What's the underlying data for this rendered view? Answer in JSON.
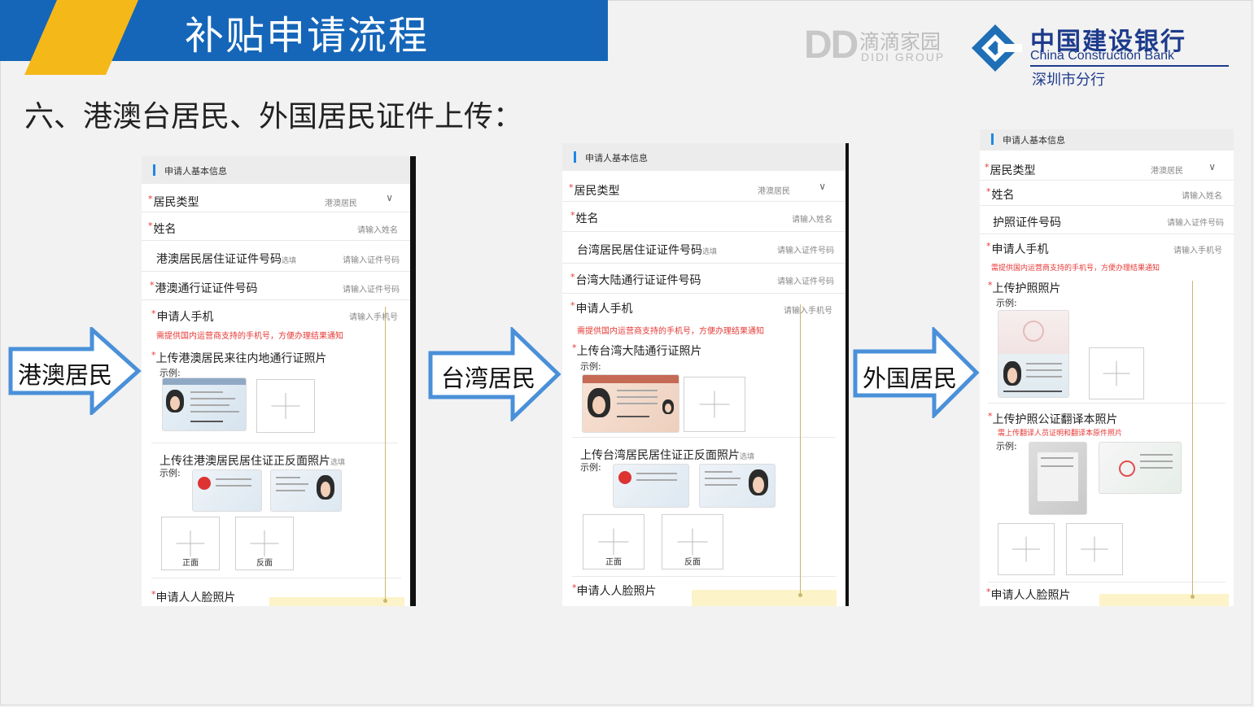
{
  "header": {
    "title": "补贴申请流程"
  },
  "logos": {
    "didi_mark": "DD",
    "didi_cn": "滴滴家园",
    "didi_en": "DIDI GROUP",
    "ccb_cn": "中国建设银行",
    "ccb_en": "China Construction Bank",
    "ccb_branch": "深圳市分行"
  },
  "section_title": "六、港澳台居民、外国居民证件上传：",
  "arrows": {
    "hk_macao": "港澳居民",
    "taiwan": "台湾居民",
    "foreign": "外国居民"
  },
  "panel_hk": {
    "header": "申请人基本信息",
    "resident_type_label": "居民类型",
    "resident_type_value": "港澳居民",
    "name_label": "姓名",
    "name_placeholder": "请输入姓名",
    "permit_label": "港澳居民居住证证件号码",
    "permit_optional": "选填",
    "permit_placeholder": "请输入证件号码",
    "pass_label": "港澳通行证证件号码",
    "pass_placeholder": "请输入证件号码",
    "phone_label": "申请人手机",
    "phone_placeholder": "请输入手机号",
    "phone_hint": "需提供国内运营商支持的手机号，方便办理结果通知",
    "upload1_label": "上传港澳居民来往内地通行证照片",
    "example": "示例:",
    "upload2_label": "上传往港澳居民居住证正反面照片",
    "upload2_optional": "选填",
    "front": "正面",
    "back": "反面",
    "face_label": "申请人人脸照片"
  },
  "panel_tw": {
    "header": "申请人基本信息",
    "resident_type_label": "居民类型",
    "resident_type_value": "港澳居民",
    "name_label": "姓名",
    "name_placeholder": "请输入姓名",
    "permit_label": "台湾居民居住证证件号码",
    "permit_optional": "选填",
    "permit_placeholder": "请输入证件号码",
    "pass_label": "台湾大陆通行证证件号码",
    "pass_placeholder": "请输入证件号码",
    "phone_label": "申请人手机",
    "phone_placeholder": "请输入手机号",
    "phone_hint": "需提供国内运营商支持的手机号，方便办理结果通知",
    "upload1_label": "上传台湾大陆通行证照片",
    "example": "示例:",
    "upload2_label": "上传台湾居民居住证正反面照片",
    "upload2_optional": "选填",
    "front": "正面",
    "back": "反面",
    "face_label": "申请人人脸照片"
  },
  "panel_fr": {
    "header": "申请人基本信息",
    "resident_type_label": "居民类型",
    "resident_type_value": "港澳居民",
    "name_label": "姓名",
    "name_placeholder": "请输入姓名",
    "passport_label": "护照证件号码",
    "passport_placeholder": "请输入证件号码",
    "phone_label": "申请人手机",
    "phone_placeholder": "请输入手机号",
    "phone_hint": "需提供国内运营商支持的手机号，方便办理结果通知",
    "upload1_label": "上传护照照片",
    "example": "示例:",
    "upload2_label": "上传护照公证翻译本照片",
    "upload2_hint": "需上传翻译人员证明和翻译本原件照片",
    "face_label": "申请人人脸照片"
  },
  "colors": {
    "banner_blue": "#1566b8",
    "banner_yellow": "#f5b819",
    "arrow_blue": "#4a90d9",
    "required_red": "#e53935",
    "ccb_blue": "#1d3b8c"
  }
}
